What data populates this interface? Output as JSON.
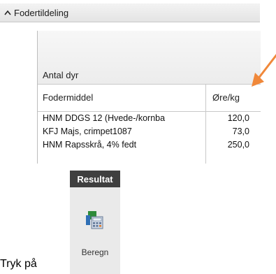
{
  "section": {
    "title": "Fodertildeling"
  },
  "grid": {
    "antal_label": "Antal dyr",
    "columns": {
      "fodermiddel": "Fodermiddel",
      "ore_kg": "Øre/kg"
    },
    "rows": [
      {
        "name": "HNM DDGS 12 (Hvede-/kornba",
        "value": "120,0"
      },
      {
        "name": "KFJ Majs, crimpet1087",
        "value": "73,0"
      },
      {
        "name": "HNM Rapsskrå, 4% fedt",
        "value": "250,0"
      }
    ]
  },
  "ribbon": {
    "tab_label": "Resultat",
    "button_label": "Beregn"
  },
  "instruction": {
    "text": "Tryk på"
  },
  "colors": {
    "arrow": "#f0883a",
    "ribbon_tab": "#3f3f3f",
    "ribbon_body": "#eaeaea"
  }
}
